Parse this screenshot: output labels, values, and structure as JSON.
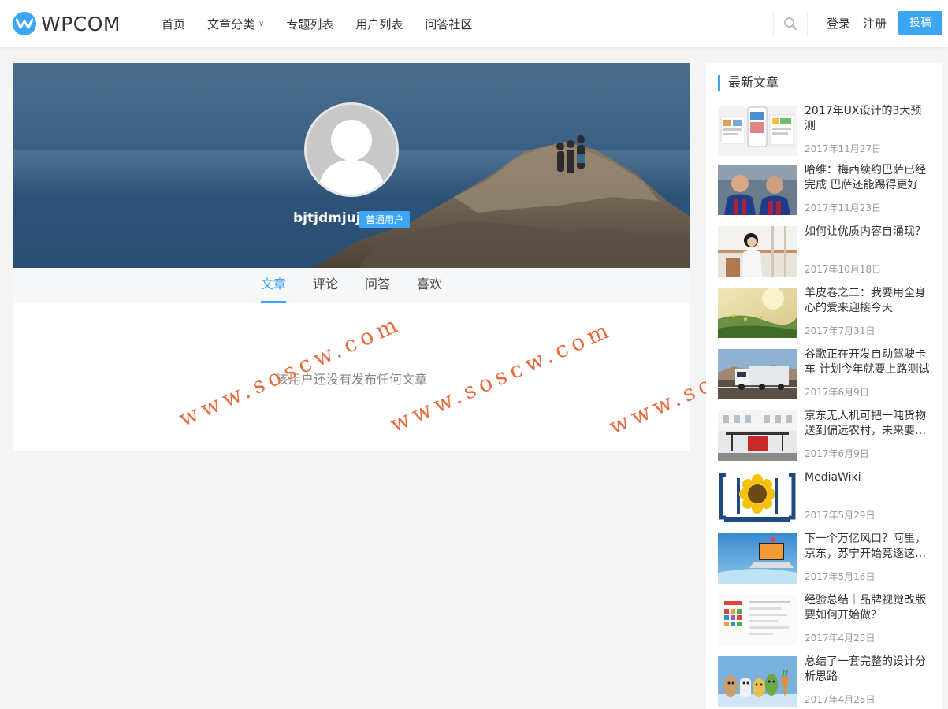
{
  "header": {
    "brand": "WPCOM",
    "nav": [
      {
        "label": "首页"
      },
      {
        "label": "文章分类",
        "has_caret": true
      },
      {
        "label": "专题列表"
      },
      {
        "label": "用户列表"
      },
      {
        "label": "问答社区"
      }
    ],
    "login": "登录",
    "register": "注册",
    "submit": "投稿"
  },
  "profile": {
    "username": "bjtjdmjuj",
    "role": "普通用户",
    "tabs": [
      "文章",
      "评论",
      "问答",
      "喜欢"
    ],
    "active_tab": 0,
    "empty_message": "该用户还没有发布任何文章"
  },
  "watermark": "www.soscw.com",
  "sidebar": {
    "title": "最新文章",
    "posts": [
      {
        "title": "2017年UX设计的3大预测",
        "date": "2017年11月27日",
        "thumb": "ux"
      },
      {
        "title": "哈维：梅西续约巴萨已经完成 巴萨还能踢得更好",
        "date": "2017年11月23日",
        "thumb": "soccer"
      },
      {
        "title": "如何让优质内容自涌现？",
        "date": "2017年10月18日",
        "thumb": "woman"
      },
      {
        "title": "羊皮卷之二：我要用全身心的爱来迎接今天",
        "date": "2017年7月31日",
        "thumb": "field"
      },
      {
        "title": "谷歌正在开发自动驾驶卡车 计划今年就要上路测试",
        "date": "2017年6月9日",
        "thumb": "truck"
      },
      {
        "title": "京东无人机可把一吨货物送到偏远农村，未来要…",
        "date": "2017年6月9日",
        "thumb": "drone"
      },
      {
        "title": "MediaWiki",
        "date": "2017年5月29日",
        "thumb": "mediawiki"
      },
      {
        "title": "下一个万亿风口？阿里，京东，苏宁开始竞逐这…",
        "date": "2017年5月16日",
        "thumb": "laptop"
      },
      {
        "title": "经验总结｜品牌视觉改版要如何开始做？",
        "date": "2017年4月25日",
        "thumb": "brand"
      },
      {
        "title": "总结了一套完整的设计分析思路",
        "date": "2017年4月25日",
        "thumb": "veggies"
      }
    ]
  },
  "colors": {
    "accent": "#3ca5f6",
    "watermark": "#e86a3c"
  }
}
